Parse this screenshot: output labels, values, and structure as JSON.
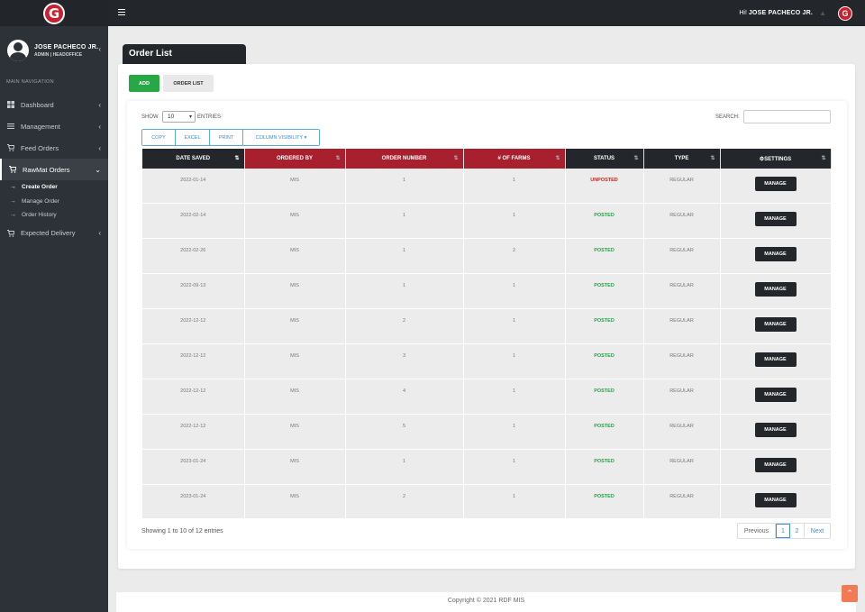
{
  "brand": {
    "logo_letter": "G",
    "brand_color": "#c8202e"
  },
  "user": {
    "name": "JOSE PACHECO JR.",
    "role": "ADMIN | HEADOFFICE"
  },
  "topbar": {
    "greeting_prefix": "Hi!",
    "greeting_name": "JOSE PACHECO JR."
  },
  "nav": {
    "header": "MAIN NAVIGATION",
    "items": [
      {
        "label": "Dashboard",
        "icon": "dashboard-icon"
      },
      {
        "label": "Management",
        "icon": "list-icon"
      },
      {
        "label": "Feed Orders",
        "icon": "cart-icon"
      },
      {
        "label": "RawMat Orders",
        "icon": "cart-icon"
      },
      {
        "label": "Expected Delivery",
        "icon": "cart-icon"
      }
    ],
    "sub_items": [
      "Create Order",
      "Manage Order",
      "Order History"
    ]
  },
  "page": {
    "title": "Order List",
    "add_label": "ADD",
    "order_list_label": "ORDER LIST"
  },
  "table_controls": {
    "show_label": "SHOW",
    "entries_value": "10",
    "entries_label": "ENTRIES",
    "search_label": "SEARCH:",
    "export_buttons": [
      "COPY",
      "EXCEL",
      "PRINT",
      "COLUMN VISIBILITY ▾"
    ]
  },
  "table": {
    "headers": [
      "DATE SAVED",
      "ORDERED BY",
      "ORDER NUMBER",
      "# OF FARMS",
      "STATUS",
      "TYPE",
      "⚙SETTINGS"
    ],
    "manage_label": "MANAGE",
    "rows": [
      {
        "date": "2022-01-14",
        "by": "MIS",
        "num": "1",
        "farms": "1",
        "status": "UNPOSTED",
        "type": "REGULAR"
      },
      {
        "date": "2022-02-14",
        "by": "MIS",
        "num": "1",
        "farms": "1",
        "status": "POSTED",
        "type": "REGULAR"
      },
      {
        "date": "2022-02-26",
        "by": "MIS",
        "num": "1",
        "farms": "2",
        "status": "POSTED",
        "type": "REGULAR"
      },
      {
        "date": "2022-09-13",
        "by": "MIS",
        "num": "1",
        "farms": "1",
        "status": "POSTED",
        "type": "REGULAR"
      },
      {
        "date": "2022-12-12",
        "by": "MIS",
        "num": "2",
        "farms": "1",
        "status": "POSTED",
        "type": "REGULAR"
      },
      {
        "date": "2022-12-12",
        "by": "MIS",
        "num": "3",
        "farms": "1",
        "status": "POSTED",
        "type": "REGULAR"
      },
      {
        "date": "2022-12-12",
        "by": "MIS",
        "num": "4",
        "farms": "1",
        "status": "POSTED",
        "type": "REGULAR"
      },
      {
        "date": "2022-12-12",
        "by": "MIS",
        "num": "5",
        "farms": "1",
        "status": "POSTED",
        "type": "REGULAR"
      },
      {
        "date": "2023-01-24",
        "by": "MIS",
        "num": "1",
        "farms": "1",
        "status": "POSTED",
        "type": "REGULAR"
      },
      {
        "date": "2023-01-24",
        "by": "MIS",
        "num": "2",
        "farms": "1",
        "status": "POSTED",
        "type": "REGULAR"
      }
    ]
  },
  "pagination": {
    "info": "Showing 1 to 10 of 12 entries",
    "prev": "Previous",
    "pages": [
      "1",
      "2"
    ],
    "next": "Next"
  },
  "footer": {
    "copyright": "Copyright © 2021 RDF MIS"
  }
}
